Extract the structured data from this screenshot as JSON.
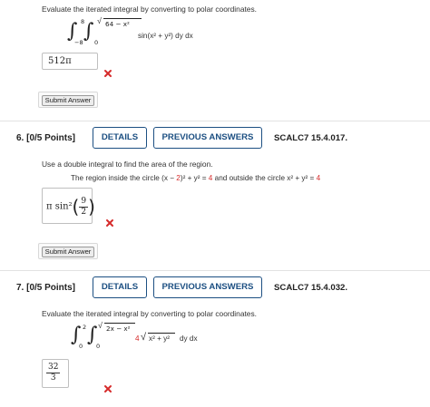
{
  "question5": {
    "prompt": "Evaluate the iterated integral by converting to polar coordinates.",
    "outer_upper": "8",
    "outer_lower": "−8",
    "inner_upper": "64 − x²",
    "inner_lower": "0",
    "integrand": "sin(x² + y²) dy dx",
    "answer": "512π",
    "submit_label": "Submit Answer"
  },
  "question6": {
    "header": "6.  [0/5 Points]",
    "details_label": "DETAILS",
    "previous_label": "PREVIOUS ANSWERS",
    "reference": "SCALC7 15.4.017.",
    "prompt": "Use a double integral to find the area of the region.",
    "region_text_a": "The region inside the circle  (x −",
    "region_val1": "2",
    "region_text_b": ")² + y² =",
    "region_val2": "4",
    "region_text_c": " and outside the circle  x² + y² =",
    "region_val3": "4",
    "answer_prefix": "π sin²",
    "answer_num": "9",
    "answer_den": "2",
    "submit_label": "Submit Answer"
  },
  "question7": {
    "header": "7.  [0/5 Points]",
    "details_label": "DETAILS",
    "previous_label": "PREVIOUS ANSWERS",
    "reference": "SCALC7 15.4.032.",
    "prompt": "Evaluate the iterated integral by converting to polar coordinates.",
    "outer_upper": "2",
    "outer_lower": "0",
    "inner_upper": "2x − x²",
    "inner_lower": "0",
    "coef": "4",
    "integrand_root": "x² + y²",
    "integrand_tail": "dy dx",
    "answer_num": "32",
    "answer_den": "3"
  },
  "colors": {
    "accent": "#1c4f82",
    "wrong": "#d62b2b"
  },
  "icons": {
    "wrong_mark": "x-mark-icon"
  }
}
